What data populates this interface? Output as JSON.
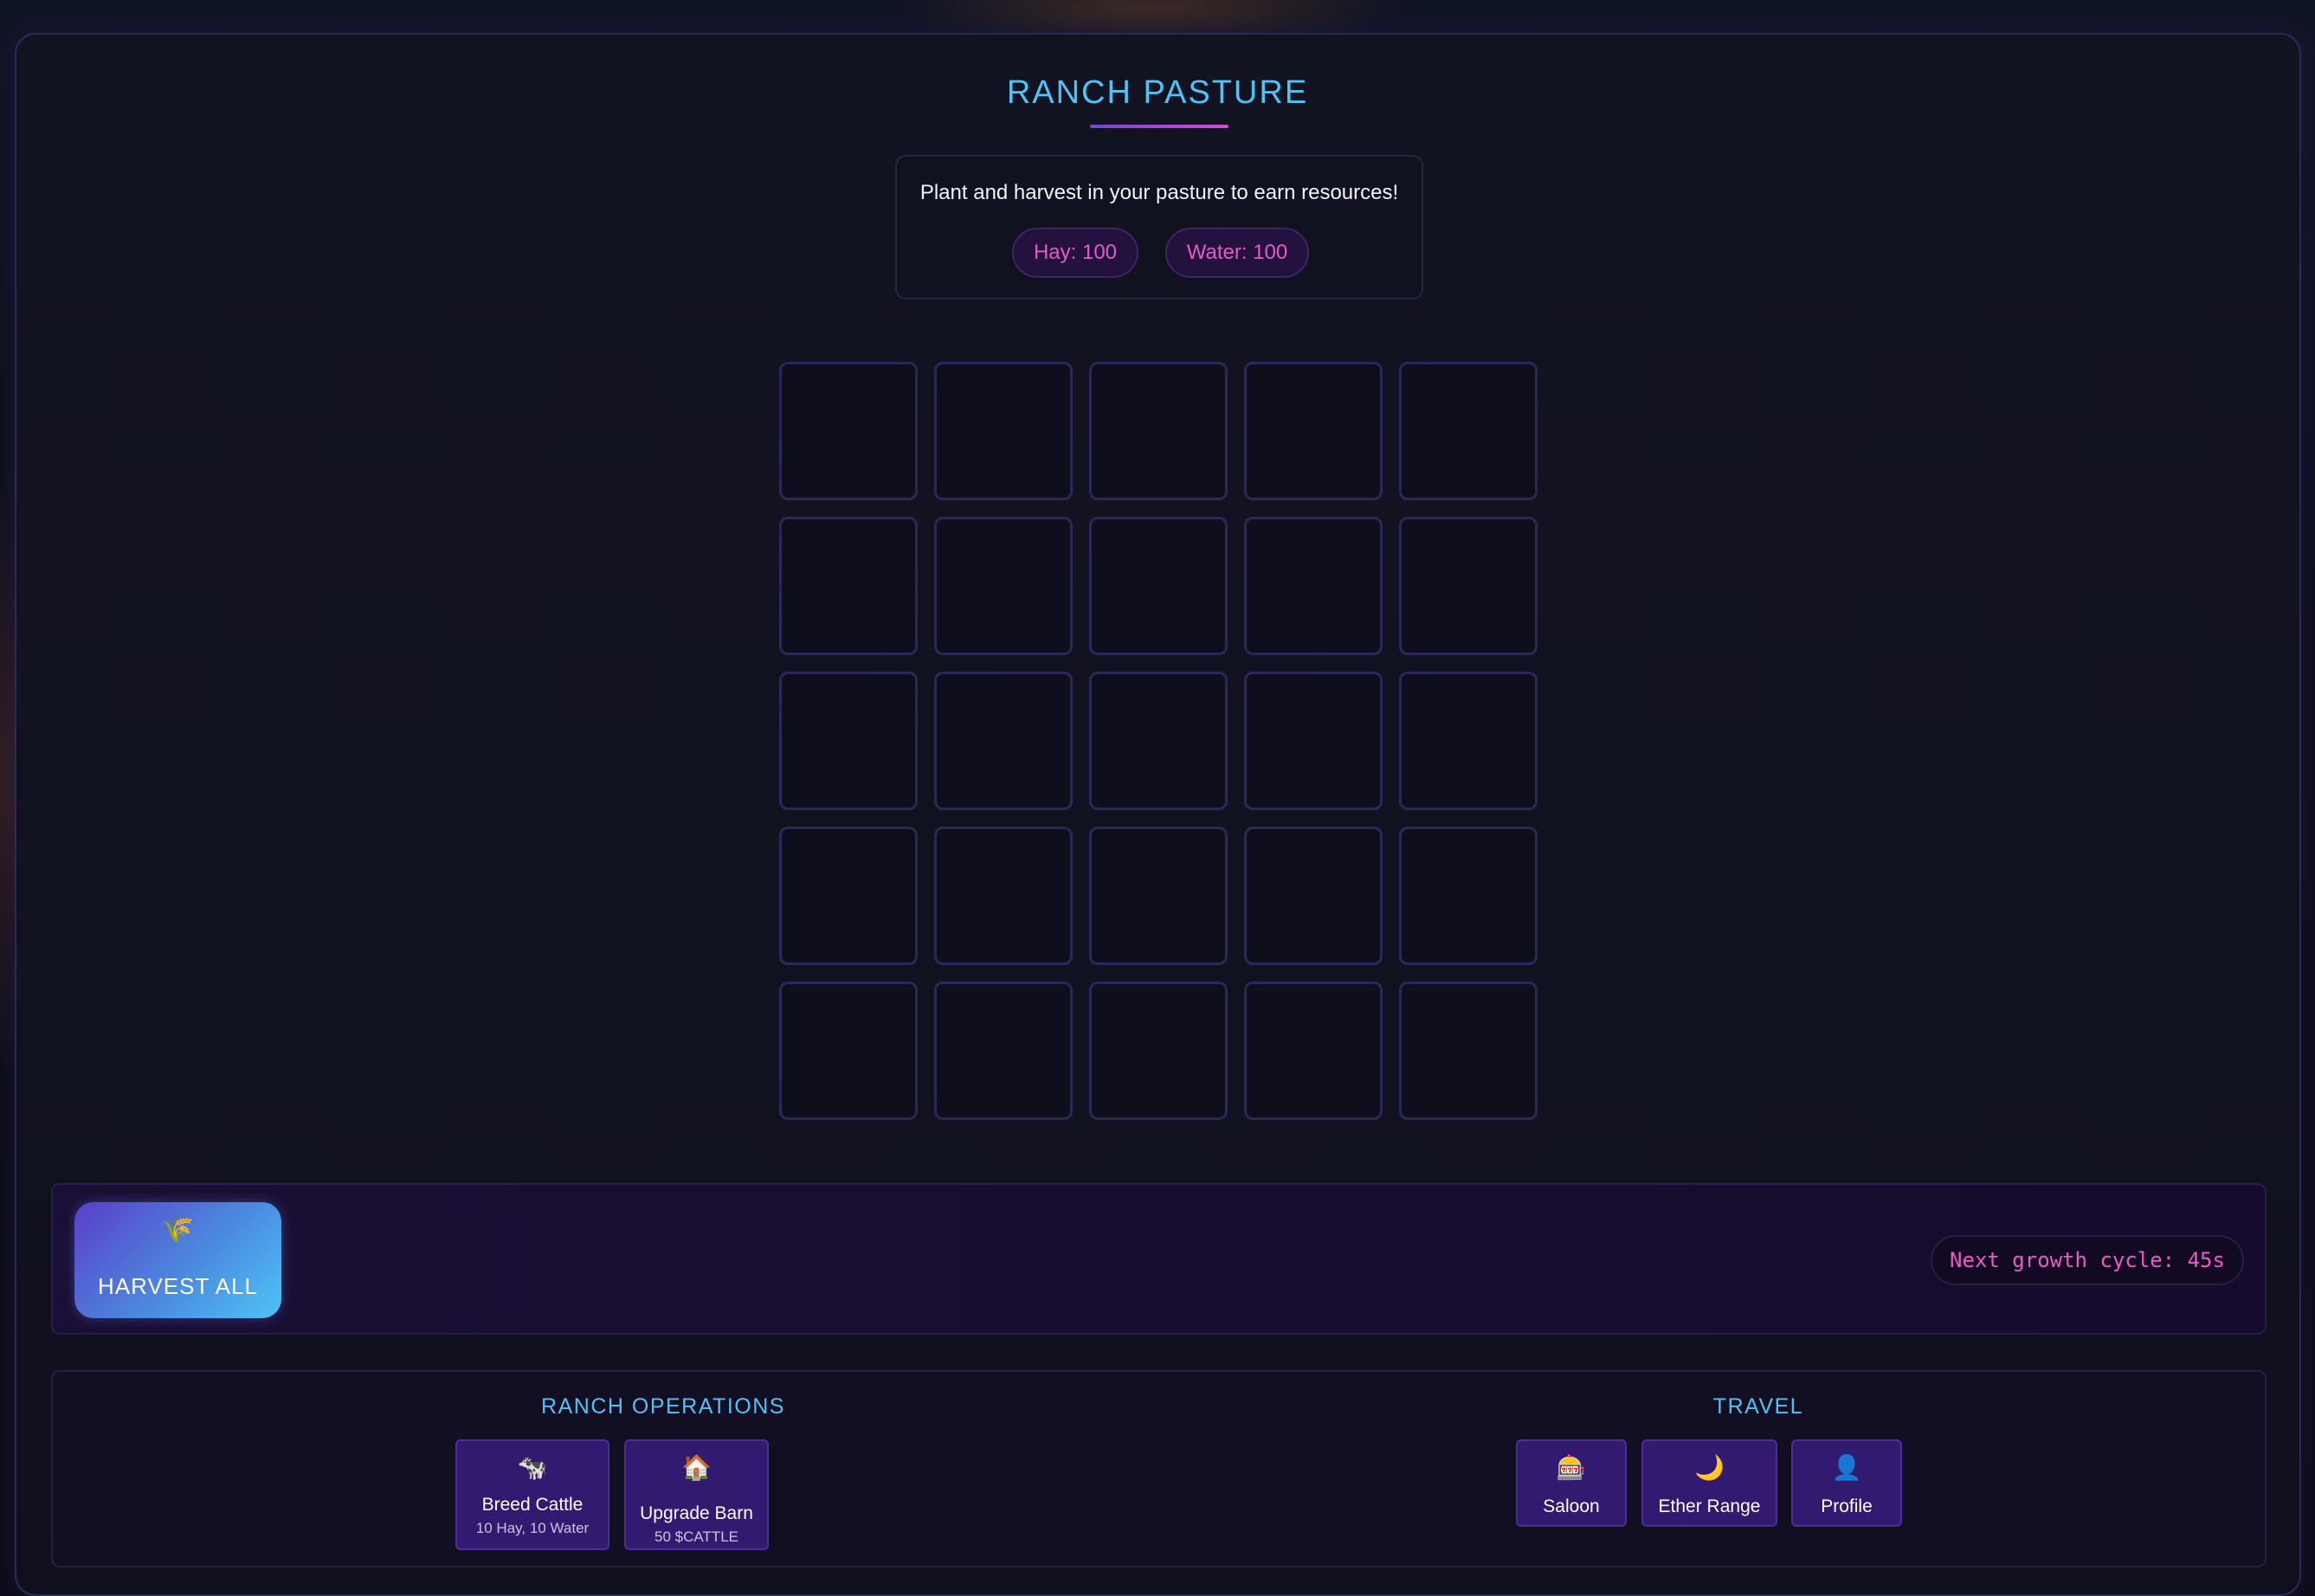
{
  "header": {
    "title": "RANCH PASTURE",
    "info_text": "Plant and harvest in your pasture to earn resources!"
  },
  "resources": {
    "hay_label": "Hay: 100",
    "water_label": "Water: 100"
  },
  "pasture": {
    "rows": 5,
    "columns": 5,
    "plots": [
      "empty",
      "empty",
      "empty",
      "empty",
      "empty",
      "empty",
      "empty",
      "empty",
      "empty",
      "empty",
      "empty",
      "empty",
      "empty",
      "empty",
      "empty",
      "empty",
      "empty",
      "empty",
      "empty",
      "empty",
      "empty",
      "empty",
      "empty",
      "empty",
      "empty"
    ]
  },
  "actions": {
    "harvest_icon": "🌾",
    "harvest_label": "HARVEST ALL",
    "cycle_text": "Next growth cycle: 45s"
  },
  "ranch_operations": {
    "title": "RANCH OPERATIONS",
    "buttons": [
      {
        "icon": "🐄",
        "label": "Breed Cattle",
        "sub": "10 Hay, 10 Water"
      },
      {
        "icon": "🏠",
        "label": "Upgrade Barn",
        "sub": "50 $CATTLE"
      }
    ]
  },
  "travel": {
    "title": "TRAVEL",
    "buttons": [
      {
        "icon": "🎰",
        "label": "Saloon"
      },
      {
        "icon": "🌙",
        "label": "Ether Range"
      },
      {
        "icon": "👤",
        "label": "Profile"
      }
    ]
  },
  "colors": {
    "accent_cyan": "#4fc3f7",
    "accent_pink": "#e45bc7",
    "button_purple": "#311a70"
  }
}
